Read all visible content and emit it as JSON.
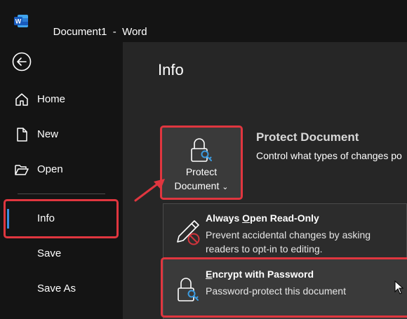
{
  "window": {
    "doc_name": "Document1",
    "separator": "-",
    "app_name": "Word"
  },
  "nav": {
    "home": "Home",
    "new": "New",
    "open": "Open",
    "info": "Info",
    "save": "Save",
    "save_as": "Save As",
    "selected": "Info"
  },
  "main": {
    "title": "Info",
    "protect_button": {
      "line1": "Protect",
      "line2": "Document",
      "dropdown_glyph": "⌄"
    },
    "protect_section": {
      "heading": "Protect Document",
      "description": "Control what types of changes po"
    },
    "menu": {
      "read_only": {
        "title_pre": "Always ",
        "title_accel": "O",
        "title_post": "pen Read-Only",
        "desc_line1": "Prevent accidental changes by asking",
        "desc_line2": "readers to opt-in to editing."
      },
      "encrypt": {
        "title_accel": "E",
        "title_post": "ncrypt with Password",
        "desc": "Password-protect this document"
      }
    }
  },
  "colors": {
    "highlight": "#e0363f",
    "word_blue": "#185abd",
    "key_blue": "#3b9be0",
    "no_red": "#d1343c"
  },
  "icons": {
    "back": "back-arrow-icon",
    "home": "home-icon",
    "new": "new-document-icon",
    "open": "folder-open-icon",
    "lock": "lock-key-icon",
    "read_only": "pencil-no-edit-icon"
  }
}
